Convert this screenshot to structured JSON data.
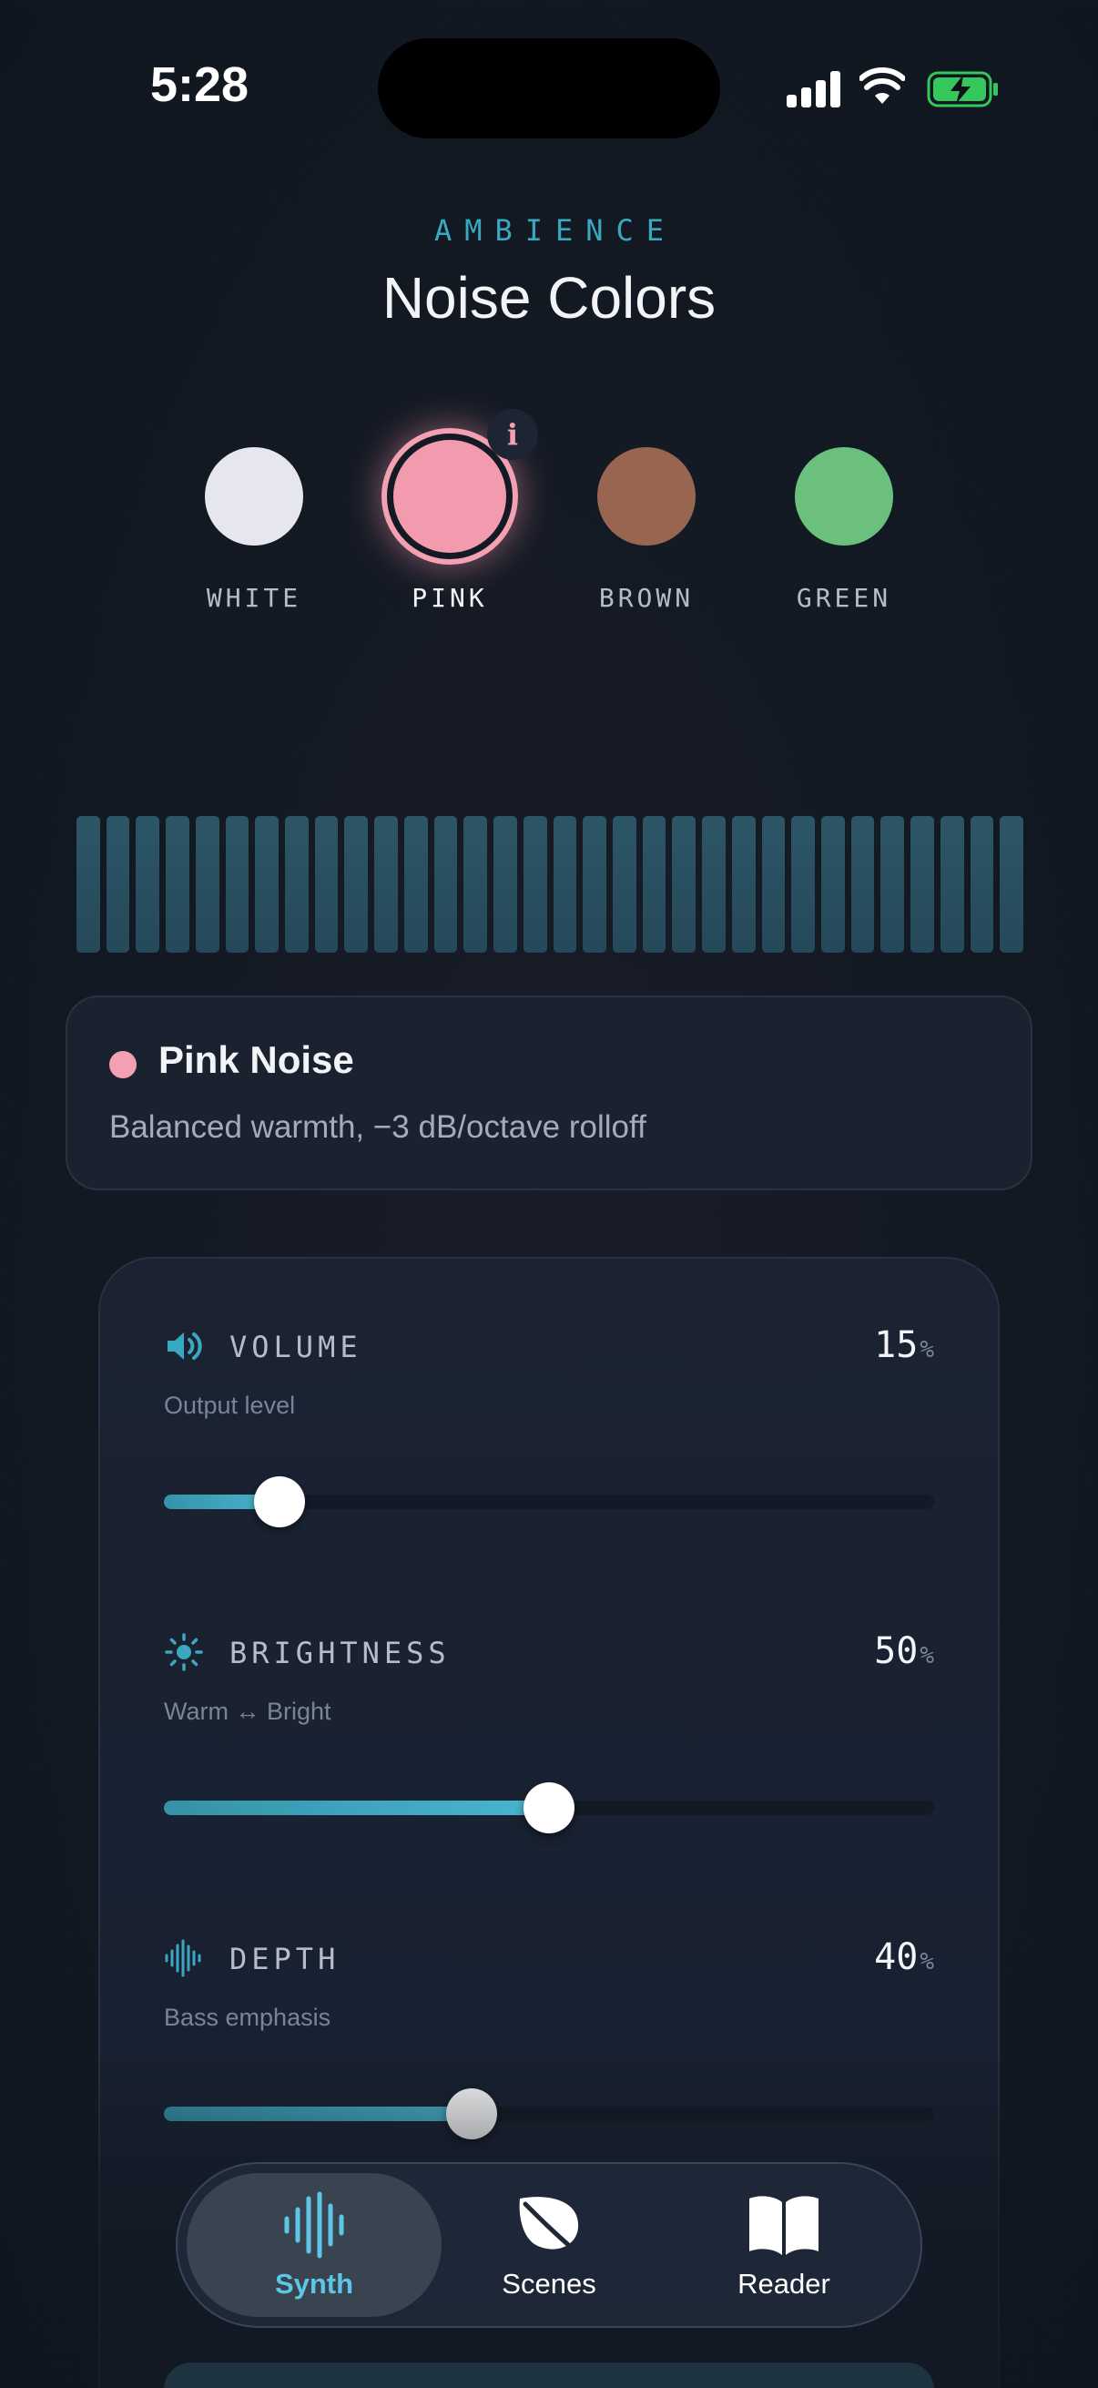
{
  "status_bar": {
    "time": "5:28"
  },
  "header": {
    "eyebrow": "AMBIENCE",
    "title": "Noise Colors"
  },
  "noise_colors": [
    {
      "label": "WHITE",
      "color": "#e6e6ef",
      "selected": false
    },
    {
      "label": "PINK",
      "color": "#f29bae",
      "selected": true
    },
    {
      "label": "BROWN",
      "color": "#986650",
      "selected": false
    },
    {
      "label": "GREEN",
      "color": "#6bc07e",
      "selected": false
    }
  ],
  "info_badge": "i",
  "visualizer": {
    "bar_count": 32
  },
  "info_card": {
    "name": "Pink Noise",
    "description": "Balanced warmth, −3 dB/octave rolloff",
    "dot_color": "#f3a0b2"
  },
  "controls": [
    {
      "icon": "speaker-icon",
      "label": "VOLUME",
      "sub": "Output level",
      "value": "15",
      "unit": "%",
      "level": 0.15
    },
    {
      "icon": "sun-icon",
      "label": "BRIGHTNESS",
      "sub": "Warm ↔ Bright",
      "value": "50",
      "unit": "%",
      "level": 0.5
    },
    {
      "icon": "waveform-icon",
      "label": "DEPTH",
      "sub": "Bass emphasis",
      "value": "40",
      "unit": "%",
      "level": 0.4
    }
  ],
  "tab_bar": {
    "items": [
      {
        "label": "Synth",
        "icon": "waveform-icon",
        "active": true
      },
      {
        "label": "Scenes",
        "icon": "leaf-icon",
        "active": false
      },
      {
        "label": "Reader",
        "icon": "book-icon",
        "active": false
      }
    ]
  },
  "colors": {
    "accent": "#4ab6d0",
    "eyebrow": "#3aa8c0",
    "pink": "#f3a0b2"
  }
}
